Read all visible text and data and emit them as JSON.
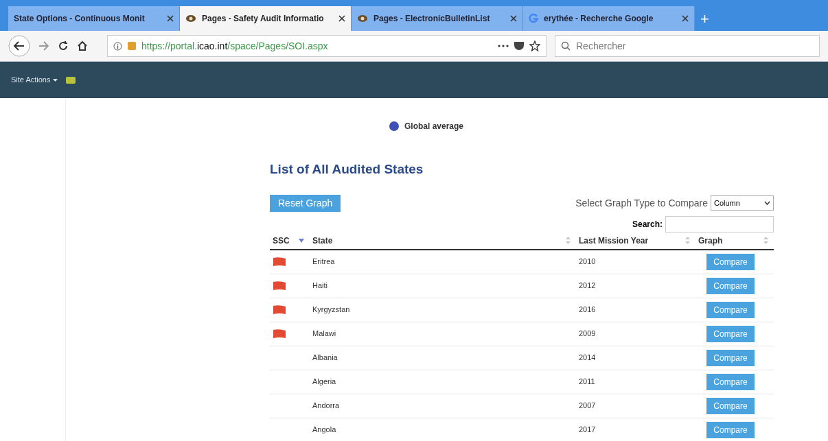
{
  "browser": {
    "tabs": [
      {
        "label": "State Options - Continuous Monit",
        "kind": "plain",
        "selected": false
      },
      {
        "label": "Pages - Safety Audit Informatio",
        "kind": "emblem",
        "selected": true
      },
      {
        "label": "Pages - ElectronicBulletinList",
        "kind": "emblem",
        "selected": false
      },
      {
        "label": "erythée - Recherche Google",
        "kind": "google",
        "selected": false
      }
    ],
    "new_tab": "+",
    "url_prefix": "https://portal.",
    "url_domain": "icao.int",
    "url_path": "/space/Pages/SOI.aspx",
    "search_placeholder": "Rechercher"
  },
  "site_bar": {
    "site_actions": "Site Actions"
  },
  "legend": {
    "label": "Global average",
    "color": "#3f51b5"
  },
  "title": "List of All Audited States",
  "reset_button": "Reset Graph",
  "graph_type": {
    "label": "Select Graph Type to Compare",
    "value": "Column"
  },
  "search": {
    "label": "Search:"
  },
  "table": {
    "columns": [
      {
        "label": "SSC",
        "sorted": true
      },
      {
        "label": "State",
        "sorted": false
      },
      {
        "label": "Last Mission Year",
        "sorted": false
      },
      {
        "label": "Graph",
        "sorted": false
      }
    ],
    "rows": [
      {
        "ssc": true,
        "state": "Eritrea",
        "year": "2010",
        "button": "Compare"
      },
      {
        "ssc": true,
        "state": "Haiti",
        "year": "2012",
        "button": "Compare"
      },
      {
        "ssc": true,
        "state": "Kyrgyzstan",
        "year": "2016",
        "button": "Compare"
      },
      {
        "ssc": true,
        "state": "Malawi",
        "year": "2009",
        "button": "Compare"
      },
      {
        "ssc": false,
        "state": "Albania",
        "year": "2014",
        "button": "Compare"
      },
      {
        "ssc": false,
        "state": "Algeria",
        "year": "2011",
        "button": "Compare"
      },
      {
        "ssc": false,
        "state": "Andorra",
        "year": "2007",
        "button": "Compare"
      },
      {
        "ssc": false,
        "state": "Angola",
        "year": "2017",
        "button": "Compare"
      }
    ]
  }
}
